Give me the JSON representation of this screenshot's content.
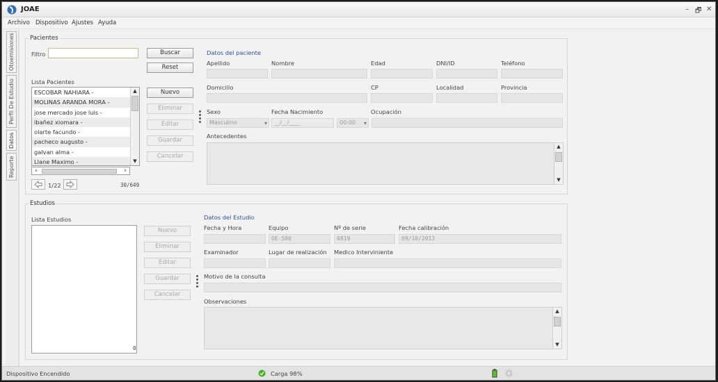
{
  "app": {
    "title": "JOAE"
  },
  "window_controls": {
    "minimize": "–",
    "restore": "🗗",
    "close": "✕"
  },
  "menu": [
    "Archivo",
    "Dispositivo",
    "Ajustes",
    "Ayuda"
  ],
  "side_tabs": [
    "Otoemisiones",
    "Perfil De Estudio",
    "Datos",
    "Reporte"
  ],
  "pacientes": {
    "legend": "Pacientes",
    "filtro_label": "Filtro",
    "filtro_value": "",
    "buscar": "Buscar",
    "reset": "Reset",
    "lista_label": "Lista Pacientes",
    "list": [
      "ESCOBAR NAHIARA -",
      "MOLINAS ARANDA MORA -",
      "jose mercado jose luis -",
      "ibañez xiomara -",
      "olarte facundo -",
      "pacheco augusto -",
      "galvan alma -",
      "Llane Maximo -"
    ],
    "page": "1/22",
    "count": "30/649",
    "buttons": {
      "nuevo": "Nuevo",
      "eliminar": "Eliminar",
      "editar": "Editar",
      "guardar": "Guardar",
      "cancelar": "Cancelar"
    },
    "datos_title": "Datos del paciente",
    "labels": {
      "apellido": "Apellido",
      "nombre": "Nombre",
      "edad": "Edad",
      "dni": "DNI/ID",
      "telefono": "Teléfono",
      "domicilio": "Domicilio",
      "cp": "CP",
      "localidad": "Localidad",
      "provincia": "Provincia",
      "sexo": "Sexo",
      "fecha_nac": "Fecha Nacimiento",
      "ocupacion": "Ocupación",
      "antecedentes": "Antecedentes"
    },
    "values": {
      "sexo": "Masculino",
      "fecha_nac": "__/__/____",
      "hora": "00:00"
    }
  },
  "estudios": {
    "legend": "Estudios",
    "lista_label": "Lista Estudios",
    "count": "0",
    "buttons": {
      "nuevo": "Nuevo",
      "eliminar": "Eliminar",
      "editar": "Editar",
      "guardar": "Guardar",
      "cancelar": "Cancelar"
    },
    "datos_title": "Datos del Estudio",
    "labels": {
      "fecha_hora": "Fecha y Hora",
      "equipo": "Equipo",
      "serie": "Nº de serie",
      "calibracion": "Fecha calibración",
      "examinador": "Examinador",
      "lugar": "Lugar de realización",
      "medico": "Medico Interviniente",
      "motivo": "Motivo de la consulta",
      "observaciones": "Observaciones"
    },
    "values": {
      "equipo": "OE-500",
      "serie": "0819",
      "calibracion": "09/10/2013"
    }
  },
  "status": {
    "device": "Dispositivo Encendido",
    "carga": "Carga 98%"
  },
  "colors": {
    "section_title": "#2e4f9c",
    "status_ok": "#4caf2a"
  }
}
